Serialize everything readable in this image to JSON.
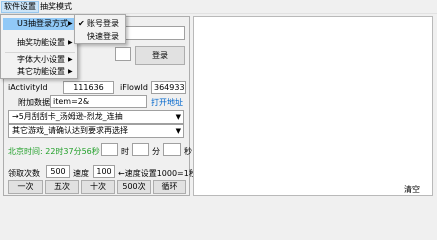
{
  "menubar": {
    "items": [
      "软件设置",
      "抽奖模式"
    ]
  },
  "dropdown": {
    "items": [
      {
        "label": "U3抽登录方式",
        "has_submenu": true
      },
      {
        "label": "抽奖功能设置",
        "has_submenu": true
      },
      {
        "label": "字体大小设置",
        "has_submenu": true
      },
      {
        "label": "其它功能设置",
        "has_submenu": true
      }
    ]
  },
  "submenu": {
    "items": [
      {
        "label": "账号登录",
        "checked": true
      },
      {
        "label": "快速登录",
        "checked": false
      }
    ]
  },
  "login": {
    "button_label": "登录"
  },
  "activity": {
    "activity_label": "iActivityId",
    "activity_value": "111636",
    "flow_label": "iFlowId",
    "flow_value": "364933",
    "extra_label": "附加数据",
    "extra_value": "item=2&",
    "open_link": "打开地址"
  },
  "combos": {
    "server": "→5月刮刮卡_汤姆逊-烈龙_连抽",
    "other": "其它游戏_请确认达到要求再选择"
  },
  "timer": {
    "label": "北京时间: 22时37分56秒",
    "hour_unit": "时",
    "minute_unit": "分",
    "second_unit": "秒",
    "button": "定时"
  },
  "draw": {
    "count_label": "领取次数",
    "count_value": "500",
    "speed_label": "速度",
    "speed_value": "100",
    "speed_hint": "←速度设置1000=1秒",
    "buttons": [
      "一次",
      "五次",
      "十次",
      "500次",
      "循环"
    ]
  },
  "log": {
    "clear_label": "清空"
  }
}
